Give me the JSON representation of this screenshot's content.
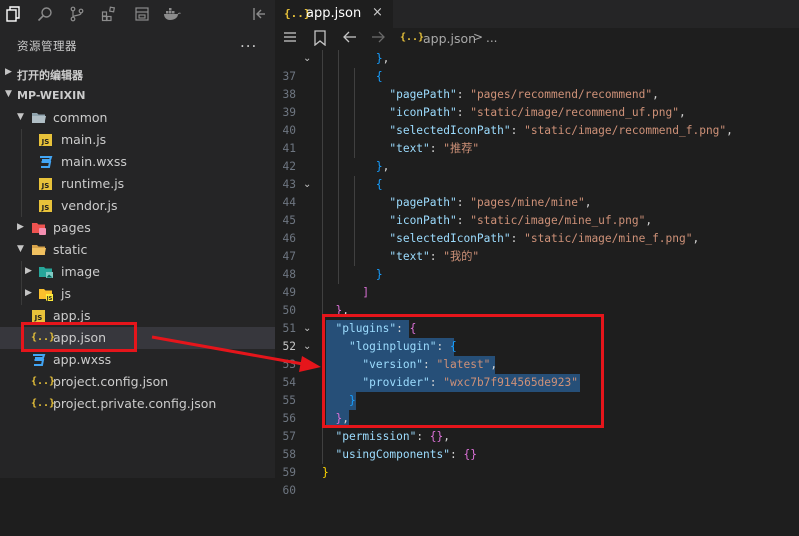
{
  "explorer": {
    "title": "资源管理器",
    "more_label": "...",
    "open_editors_label": "打开的编辑器",
    "project_label": "MP-WEIXIN"
  },
  "tree": {
    "common": "common",
    "main_js": "main.js",
    "main_wxss": "main.wxss",
    "runtime_js": "runtime.js",
    "vendor_js": "vendor.js",
    "pages": "pages",
    "static": "static",
    "image": "image",
    "js": "js",
    "app_js": "app.js",
    "app_json": "app.json",
    "app_wxss": "app.wxss",
    "project_config": "project.config.json",
    "project_private_config": "project.private.config.json"
  },
  "editor": {
    "tab_icon": "{..}",
    "tab_label": "app.json",
    "tab_close": "×",
    "breadcrumb_icon": "{..}",
    "breadcrumb_file": "app.json",
    "breadcrumb_sep": ">",
    "breadcrumb_more": "..."
  },
  "code": {
    "line_numbers": [
      "37",
      "38",
      "39",
      "40",
      "41",
      "42",
      "43",
      "44",
      "45",
      "46",
      "47",
      "48",
      "49",
      "50",
      "51",
      "52",
      "53",
      "54",
      "55",
      "56",
      "57",
      "58",
      "59",
      "60"
    ],
    "k_pagePath": "\"pagePath\"",
    "k_iconPath": "\"iconPath\"",
    "k_selectedIconPath": "\"selectedIconPath\"",
    "k_text": "\"text\"",
    "v_recommend_path": "\"pages/recommend/recommend\"",
    "v_recommend_icon": "\"static/image/recommend_uf.png\"",
    "v_recommend_sel": "\"static/image/recommend_f.png\"",
    "v_recommend_text": "\"推荐\"",
    "v_mine_path": "\"pages/mine/mine\"",
    "v_mine_icon": "\"static/image/mine_uf.png\"",
    "v_mine_sel": "\"static/image/mine_f.png\"",
    "v_mine_text": "\"我的\"",
    "k_plugins": "\"plugins\"",
    "k_loginplugin": "\"loginplugin\"",
    "k_version": "\"version\"",
    "v_version": "\"latest\"",
    "k_provider": "\"provider\"",
    "v_provider": "\"wxc7b7f914565de923\"",
    "k_permission": "\"permission\"",
    "k_usingComponents": "\"usingComponents\""
  },
  "colors": {
    "annotation_red": "#e5151b",
    "selection": "#264f78",
    "json_icon": "#e8c23a"
  }
}
